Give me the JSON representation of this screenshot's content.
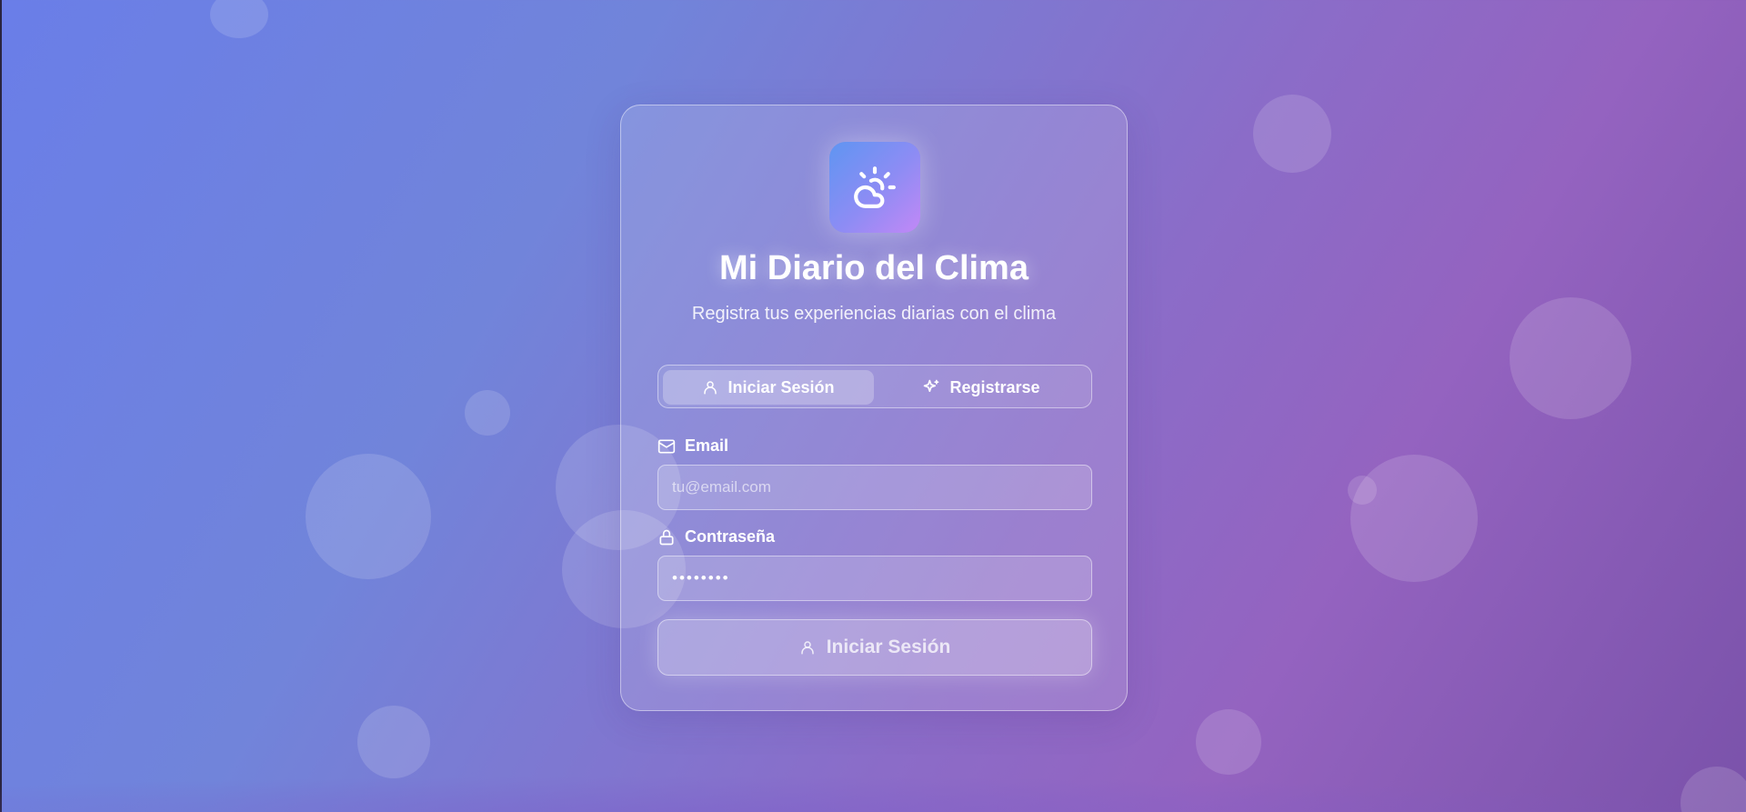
{
  "app": {
    "title": "Mi Diario del Clima",
    "subtitle": "Registra tus experiencias diarias con el clima",
    "logo_icon": "cloud-sun-icon"
  },
  "tabs": {
    "login_label": "Iniciar Sesión",
    "login_icon": "user-icon",
    "register_label": "Registrarse",
    "register_icon": "sparkles-icon",
    "active": "login"
  },
  "form": {
    "email_label": "Email",
    "email_icon": "mail-icon",
    "email_placeholder": "tu@email.com",
    "email_value": "",
    "password_label": "Contraseña",
    "password_icon": "lock-icon",
    "password_value": "••••••••",
    "submit_label": "Iniciar Sesión",
    "submit_icon": "user-icon"
  },
  "colors": {
    "logo_gradient_start": "#5f95f2",
    "logo_gradient_end": "#c288f6",
    "text": "#ffffff"
  }
}
